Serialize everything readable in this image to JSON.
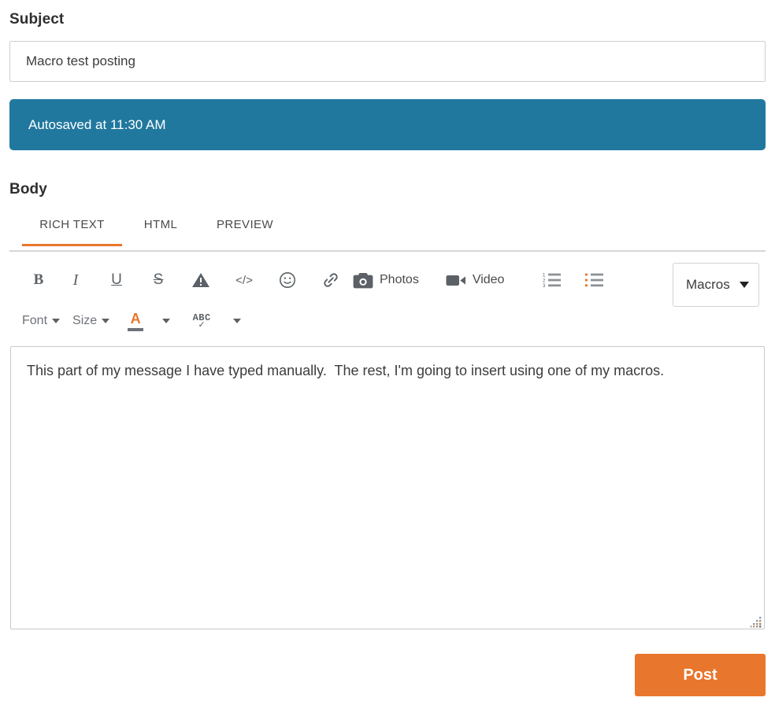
{
  "subject": {
    "label": "Subject",
    "value": "Macro test posting",
    "placeholder": "Subject"
  },
  "autosave": {
    "message": "Autosaved at 11:30 AM",
    "color": "#21789f"
  },
  "body": {
    "label": "Body",
    "tabs": [
      {
        "label": "RICH TEXT",
        "active": true
      },
      {
        "label": "HTML",
        "active": false
      },
      {
        "label": "PREVIEW",
        "active": false
      }
    ],
    "active_tab_color": "#e8762c",
    "content": "This part of my message I have typed manually.  The rest, I'm going to insert using one of my macros.",
    "placeholder": ""
  },
  "toolbar": {
    "row1": [
      {
        "name": "bold-icon",
        "label": "B"
      },
      {
        "name": "italic-icon",
        "label": "I"
      },
      {
        "name": "underline-icon",
        "label": "U"
      },
      {
        "name": "strikethrough-icon",
        "label": "S"
      },
      {
        "name": "spoiler-warning-icon",
        "label": ""
      },
      {
        "name": "code-icon",
        "label": "</>"
      },
      {
        "name": "emoji-icon",
        "label": ""
      },
      {
        "name": "link-icon",
        "label": ""
      },
      {
        "name": "photos-button",
        "label": "Photos"
      },
      {
        "name": "video-button",
        "label": "Video"
      },
      {
        "name": "numbered-list-icon",
        "label": ""
      },
      {
        "name": "bulleted-list-icon",
        "label": ""
      }
    ],
    "row2": {
      "font_label": "Font",
      "size_label": "Size",
      "text_color_glyph": "A",
      "spellcheck_glyph": "ABC",
      "spellcheck_check": "✓"
    },
    "macro_select": {
      "value": "Macros",
      "options": [
        "Macros"
      ]
    }
  },
  "actions": {
    "post_label": "Post",
    "post_color": "#e8762c"
  }
}
